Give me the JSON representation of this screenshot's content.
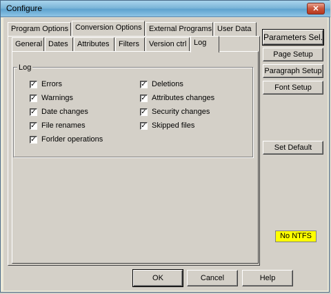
{
  "window": {
    "title": "Configure",
    "close_label": "✕"
  },
  "main_tabs": [
    {
      "label": "Program Options"
    },
    {
      "label": "Conversion Options"
    },
    {
      "label": "External Programs"
    },
    {
      "label": "User Data"
    }
  ],
  "sub_tabs": [
    {
      "label": "General"
    },
    {
      "label": "Dates"
    },
    {
      "label": "Attributes"
    },
    {
      "label": "Filters"
    },
    {
      "label": "Version ctrl"
    },
    {
      "label": "Log"
    }
  ],
  "log_group": {
    "label": "Log",
    "left": [
      {
        "label": "Errors",
        "checked": true
      },
      {
        "label": "Warnings",
        "checked": true
      },
      {
        "label": "Date changes",
        "checked": true
      },
      {
        "label": "File renames",
        "checked": true
      },
      {
        "label": "Forlder operations",
        "checked": true
      }
    ],
    "right": [
      {
        "label": "Deletions",
        "checked": true
      },
      {
        "label": "Attributes changes",
        "checked": true
      },
      {
        "label": "Security changes",
        "checked": true
      },
      {
        "label": "Skipped files",
        "checked": true
      }
    ]
  },
  "side_buttons": {
    "parameters": "Parameters Sel.",
    "page_setup": "Page Setup",
    "paragraph_setup": "Paragraph Setup",
    "font_setup": "Font Setup",
    "set_default": "Set Default"
  },
  "status_badge": "No NTFS",
  "footer": {
    "ok": "OK",
    "cancel": "Cancel",
    "help": "Help"
  },
  "colors": {
    "badge": "#ffff00",
    "face": "#d4d0c8",
    "title_gradient": "#7db6d9"
  }
}
